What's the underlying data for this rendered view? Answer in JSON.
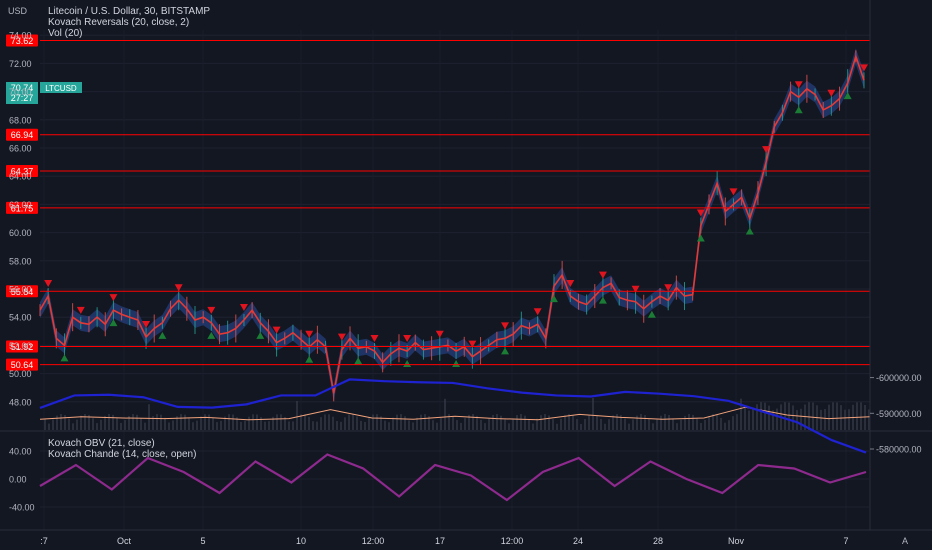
{
  "chart_header": {
    "currency": "USD",
    "symbol_line": "Litecoin / U.S. Dollar, 30, BITSTAMP",
    "indicator_1": "Kovach Reversals (20, close, 2)",
    "indicator_2": "Vol (20)",
    "lower_indicator_1": "Kovach OBV (21, close)",
    "lower_indicator_2": "Kovach Chande (14, close, open)",
    "auto_label": "A"
  },
  "price_badge": {
    "symbol": "LTCUSD",
    "price": "70.74",
    "countdown": "27:27",
    "color": "#26a69a"
  },
  "levels": [
    {
      "label": "73.62",
      "value": 73.62
    },
    {
      "label": "66.94",
      "value": 66.94
    },
    {
      "label": "64.37",
      "value": 64.37
    },
    {
      "label": "61.75",
      "value": 61.75
    },
    {
      "label": "55.84",
      "value": 55.84
    },
    {
      "label": "51.92",
      "value": 51.92
    },
    {
      "label": "50.64",
      "value": 50.64
    }
  ],
  "colors": {
    "background": "#131722",
    "level_line": "#ff0000",
    "up_marker": "#1b7c35",
    "down_marker": "#e0141e",
    "price_line": "#e53935",
    "band": "#2a4c9c",
    "oscillator": "#8e2a8e",
    "obv": "#1e22d0",
    "volume_line": "#f3a37c"
  },
  "chart_data": [
    {
      "type": "line",
      "title": "Litecoin / U.S. Dollar, 30, BITSTAMP",
      "ylabel": "USD",
      "ylim": [
        46,
        74
      ],
      "y_ticks": [
        "48.00",
        "50.00",
        "52.00",
        "54.00",
        "56.00",
        "58.00",
        "60.00",
        "62.00",
        "64.00",
        "66.00",
        "68.00",
        "70.00",
        "72.00",
        "74.00"
      ],
      "x_ticks": [
        ":7",
        "Oct",
        "5",
        "10",
        "12:00",
        "17",
        "12:00",
        "24",
        "28",
        "Nov",
        "7"
      ],
      "x": [
        0,
        3,
        6,
        9,
        12,
        15,
        18,
        21,
        24,
        27,
        30,
        33,
        36,
        39,
        42,
        45,
        48,
        51,
        54,
        57,
        60,
        63,
        66,
        69,
        72,
        75,
        78,
        81,
        84,
        87,
        90,
        93,
        96,
        99,
        102,
        105,
        108,
        111,
        114,
        117,
        120,
        123,
        126,
        129,
        132,
        135,
        138,
        141,
        144,
        147,
        150,
        153,
        156,
        159,
        162,
        165,
        168,
        171,
        174,
        177,
        180,
        183,
        186,
        189,
        192,
        195,
        198,
        201,
        204,
        207,
        210,
        213,
        216,
        219,
        222,
        225,
        228,
        231,
        234,
        237,
        240
      ],
      "series": [
        {
          "values": [
            54.5,
            55.5,
            52.5,
            52.0,
            54.0,
            53.6,
            53.5,
            54.0,
            53.5,
            54.5,
            54.2,
            54.0,
            53.8,
            52.6,
            53.2,
            53.6,
            54.6,
            55.2,
            54.6,
            53.8,
            54.0,
            53.6,
            52.8,
            52.9,
            53.2,
            53.8,
            54.5,
            53.6,
            53.0,
            52.2,
            52.5,
            52.9,
            52.4,
            51.9,
            52.4,
            51.9,
            48.6,
            51.7,
            52.5,
            51.8,
            51.9,
            51.6,
            50.8,
            51.4,
            51.8,
            51.6,
            52.2,
            51.7,
            51.8,
            51.9,
            52.0,
            51.6,
            51.9,
            51.2,
            51.6,
            52.0,
            52.4,
            52.5,
            52.8,
            53.4,
            53.2,
            53.5,
            52.5,
            56.2,
            57.0,
            55.5,
            55.1,
            54.9,
            55.5,
            56.1,
            56.4,
            55.4,
            55.2,
            55.1,
            54.6,
            55.1,
            55.5,
            55.2,
            56.1,
            55.5,
            55.6
          ]
        },
        {
          "values": [
            60.5,
            62.0,
            63.5,
            61.5,
            62.0,
            62.5,
            61.0,
            62.8,
            65.0,
            67.5,
            68.5,
            70.0,
            69.6,
            70.2,
            69.8,
            68.7,
            69.0,
            69.5,
            70.6,
            72.5,
            70.8
          ]
        }
      ],
      "volume": [
        0.8,
        1.2,
        1.0,
        0.9,
        1.1,
        0.7,
        0.9,
        2.4,
        1.0,
        0.8,
        1.3,
        0.9,
        0.7,
        1.6,
        1.1,
        0.8,
        1.0,
        2.8,
        1.5,
        0.9,
        1.2
      ]
    },
    {
      "type": "line",
      "title": "Kovach OBV (21, close) / Kovach Chande (14, close, open)",
      "ylim_left": [
        -50,
        50
      ],
      "y_ticks_left": [
        "40.00",
        "0.00",
        "-40.00"
      ],
      "ylim_right": [
        -602000,
        -578000
      ],
      "y_ticks_right": [
        "-580000.00",
        "-590000.00",
        "-600000.00"
      ],
      "series": [
        {
          "name": "Kovach Chande (14, close, open)",
          "values": [
            -10,
            20,
            -15,
            30,
            10,
            -20,
            25,
            -5,
            35,
            15,
            -25,
            20,
            5,
            -30,
            10,
            30,
            -10,
            25,
            0,
            -20,
            20,
            15,
            -5,
            10
          ]
        },
        {
          "name": "Kovach OBV (21, close)",
          "values": [
            -591500,
            -595000,
            -595200,
            -594500,
            -591800,
            -591600,
            -592500,
            -595000,
            -595000,
            -599500,
            -599000,
            -598700,
            -598500,
            -597000,
            -595800,
            -595000,
            -594700,
            -596000,
            -595500,
            -594800,
            -593500,
            -590500,
            -587500,
            -582500,
            -579000
          ]
        }
      ]
    }
  ]
}
